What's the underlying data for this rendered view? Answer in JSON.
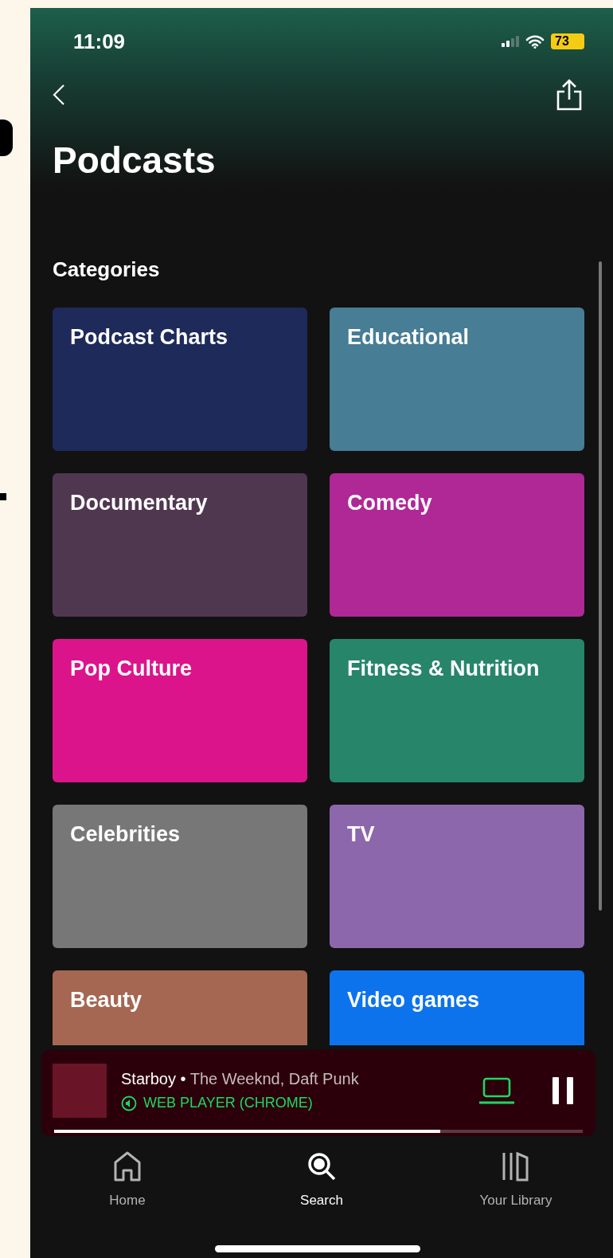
{
  "status_bar": {
    "time": "11:09",
    "battery": "73"
  },
  "header": {
    "title": "Podcasts"
  },
  "section_title": "Categories",
  "categories": [
    {
      "label": "Podcast Charts",
      "color": "#1e2a5a"
    },
    {
      "label": "Educational",
      "color": "#477d95"
    },
    {
      "label": "Documentary",
      "color": "#503750"
    },
    {
      "label": "Comedy",
      "color": "#af2896"
    },
    {
      "label": "Pop Culture",
      "color": "#dc148c"
    },
    {
      "label": "Fitness & Nutrition",
      "color": "#27856a"
    },
    {
      "label": "Celebrities",
      "color": "#777777"
    },
    {
      "label": "TV",
      "color": "#8d67ab"
    },
    {
      "label": "Beauty",
      "color": "#a56752"
    },
    {
      "label": "Video games",
      "color": "#0d73ec"
    }
  ],
  "now_playing": {
    "title": "Starboy",
    "separator": "•",
    "artists": "The Weeknd, Daft Punk",
    "device": "WEB PLAYER (CHROME)",
    "level": 0.73
  },
  "nav": [
    {
      "label": "Home",
      "kind": "home",
      "selected": false
    },
    {
      "label": "Search",
      "kind": "search",
      "selected": true
    },
    {
      "label": "Your Library",
      "kind": "library",
      "selected": false
    }
  ]
}
